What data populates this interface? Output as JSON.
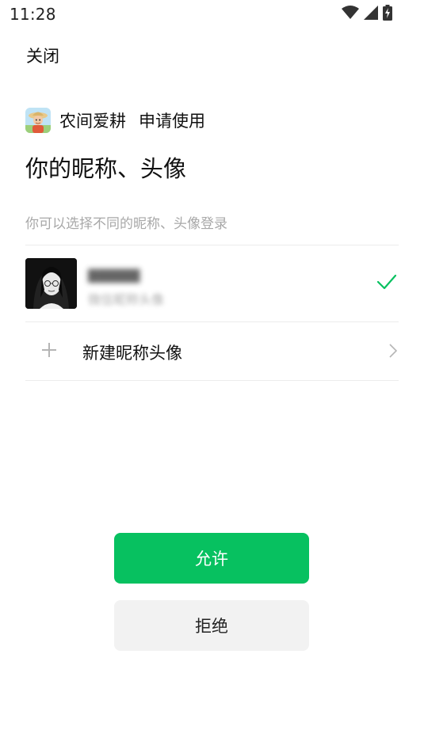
{
  "status_bar": {
    "time": "11:28",
    "icons": [
      "wifi-icon",
      "cellular-signal-icon",
      "battery-charging-icon"
    ]
  },
  "header": {
    "close_label": "关闭"
  },
  "request": {
    "app_name": "农间爱耕",
    "action_text": "申请使用",
    "app_icon": "app-icon"
  },
  "main": {
    "title": "你的昵称、头像",
    "hint": "你可以选择不同的昵称、头像登录"
  },
  "profile": {
    "name": "▇▇▇▇▇",
    "subtitle": "微信昵称头像",
    "selected": true
  },
  "new_option": {
    "label": "新建昵称头像"
  },
  "buttons": {
    "allow_label": "允许",
    "deny_label": "拒绝"
  },
  "colors": {
    "accent": "#07c160",
    "secondary_button_bg": "#f2f2f2",
    "hint_text": "#a8a8a8"
  }
}
